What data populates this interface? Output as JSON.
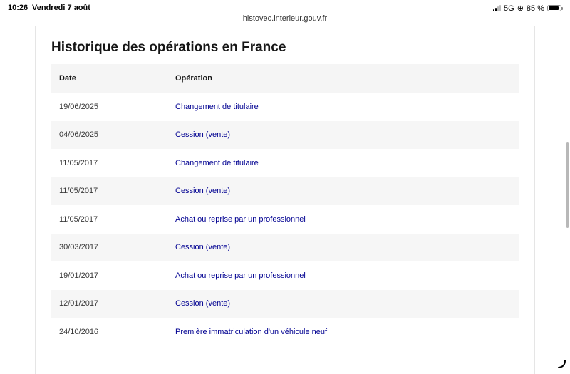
{
  "status_bar": {
    "time": "10:26",
    "date": "Vendredi 7 août",
    "network": "5G",
    "battery": "85 %",
    "battery_level": 0.85
  },
  "browser": {
    "url": "histovec.interieur.gouv.fr"
  },
  "section": {
    "title": "Historique des opérations en France"
  },
  "table": {
    "headers": {
      "date": "Date",
      "operation": "Opération"
    },
    "rows": [
      {
        "date": "19/06/2025",
        "operation": "Changement de titulaire"
      },
      {
        "date": "04/06/2025",
        "operation": "Cession (vente)"
      },
      {
        "date": "11/05/2017",
        "operation": "Changement de titulaire"
      },
      {
        "date": "11/05/2017",
        "operation": "Cession (vente)"
      },
      {
        "date": "11/05/2017",
        "operation": "Achat ou reprise par un professionnel"
      },
      {
        "date": "30/03/2017",
        "operation": "Cession (vente)"
      },
      {
        "date": "19/01/2017",
        "operation": "Achat ou reprise par un professionnel"
      },
      {
        "date": "12/01/2017",
        "operation": "Cession (vente)"
      },
      {
        "date": "24/10/2016",
        "operation": "Première immatriculation d'un véhicule neuf"
      }
    ]
  },
  "colors": {
    "link": "#000091",
    "header_bg": "#f5f5f5",
    "stripe_bg": "#f6f6f6"
  }
}
